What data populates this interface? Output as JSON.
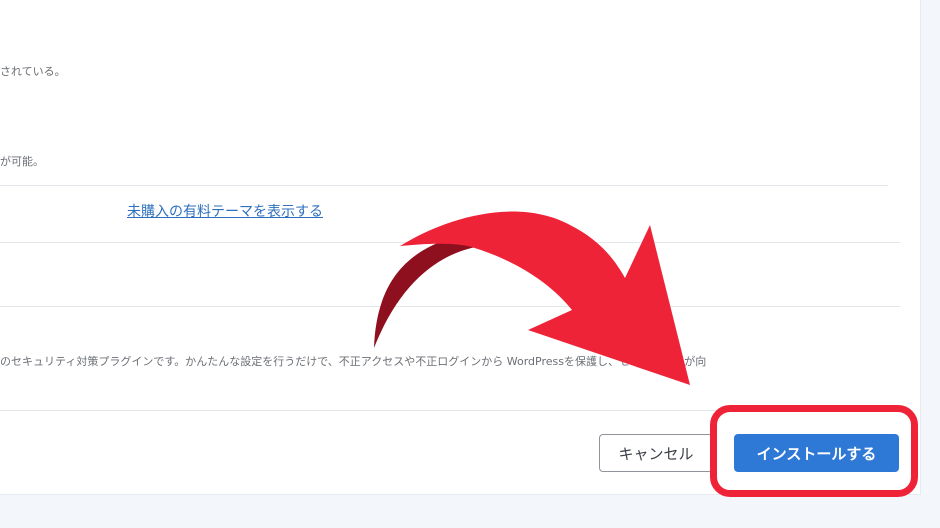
{
  "content": {
    "desc1": "されている。",
    "desc2": "が可能。",
    "show_unpurchased_link": "未購入の有料テーマを表示する",
    "plugin_description": "のセキュリティ対策プラグインです。かんたんな設定を行うだけで、不正アクセスや不正ログインから WordPressを保護し、セキュリティが向"
  },
  "footer": {
    "cancel_label": "キャンセル",
    "install_label": "インストールする"
  },
  "annotation": {
    "arrow_color": "#ef2338",
    "arrow_shadow_color": "#8e0f1d",
    "highlight_color": "#ef2338"
  }
}
